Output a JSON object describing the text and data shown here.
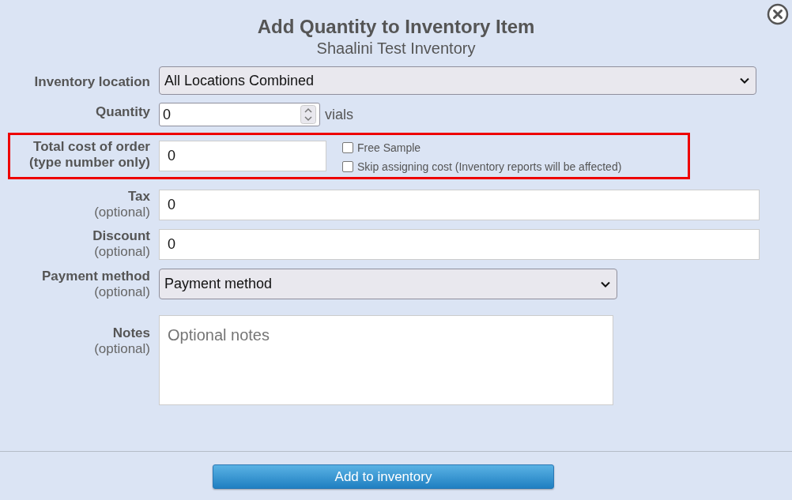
{
  "dialog": {
    "title": "Add Quantity to Inventory Item",
    "subtitle": "Shaalini Test Inventory"
  },
  "fields": [
    {
      "kind": "select",
      "label": "Inventory location",
      "value": "All Locations Combined"
    },
    {
      "kind": "number",
      "label": "Quantity",
      "value": "0",
      "unit": "vials"
    },
    {
      "kind": "cost",
      "label": "Total cost of order",
      "sublabel": "(type number only)",
      "value": "0",
      "highlighted": true,
      "checkboxes": [
        {
          "label": "Free Sample",
          "checked": false
        },
        {
          "label": "Skip assigning cost (Inventory reports will be affected)",
          "checked": false
        }
      ]
    },
    {
      "kind": "text",
      "label": "Tax",
      "sublabel": "(optional)",
      "value": "0"
    },
    {
      "kind": "text",
      "label": "Discount",
      "sublabel": "(optional)",
      "value": "0"
    },
    {
      "kind": "select",
      "label": "Payment method",
      "sublabel": "(optional)",
      "value": "Payment method"
    },
    {
      "kind": "textarea",
      "label": "Notes",
      "sublabel": "(optional)",
      "placeholder": "Optional notes"
    }
  ],
  "submit_button": "Add to inventory"
}
